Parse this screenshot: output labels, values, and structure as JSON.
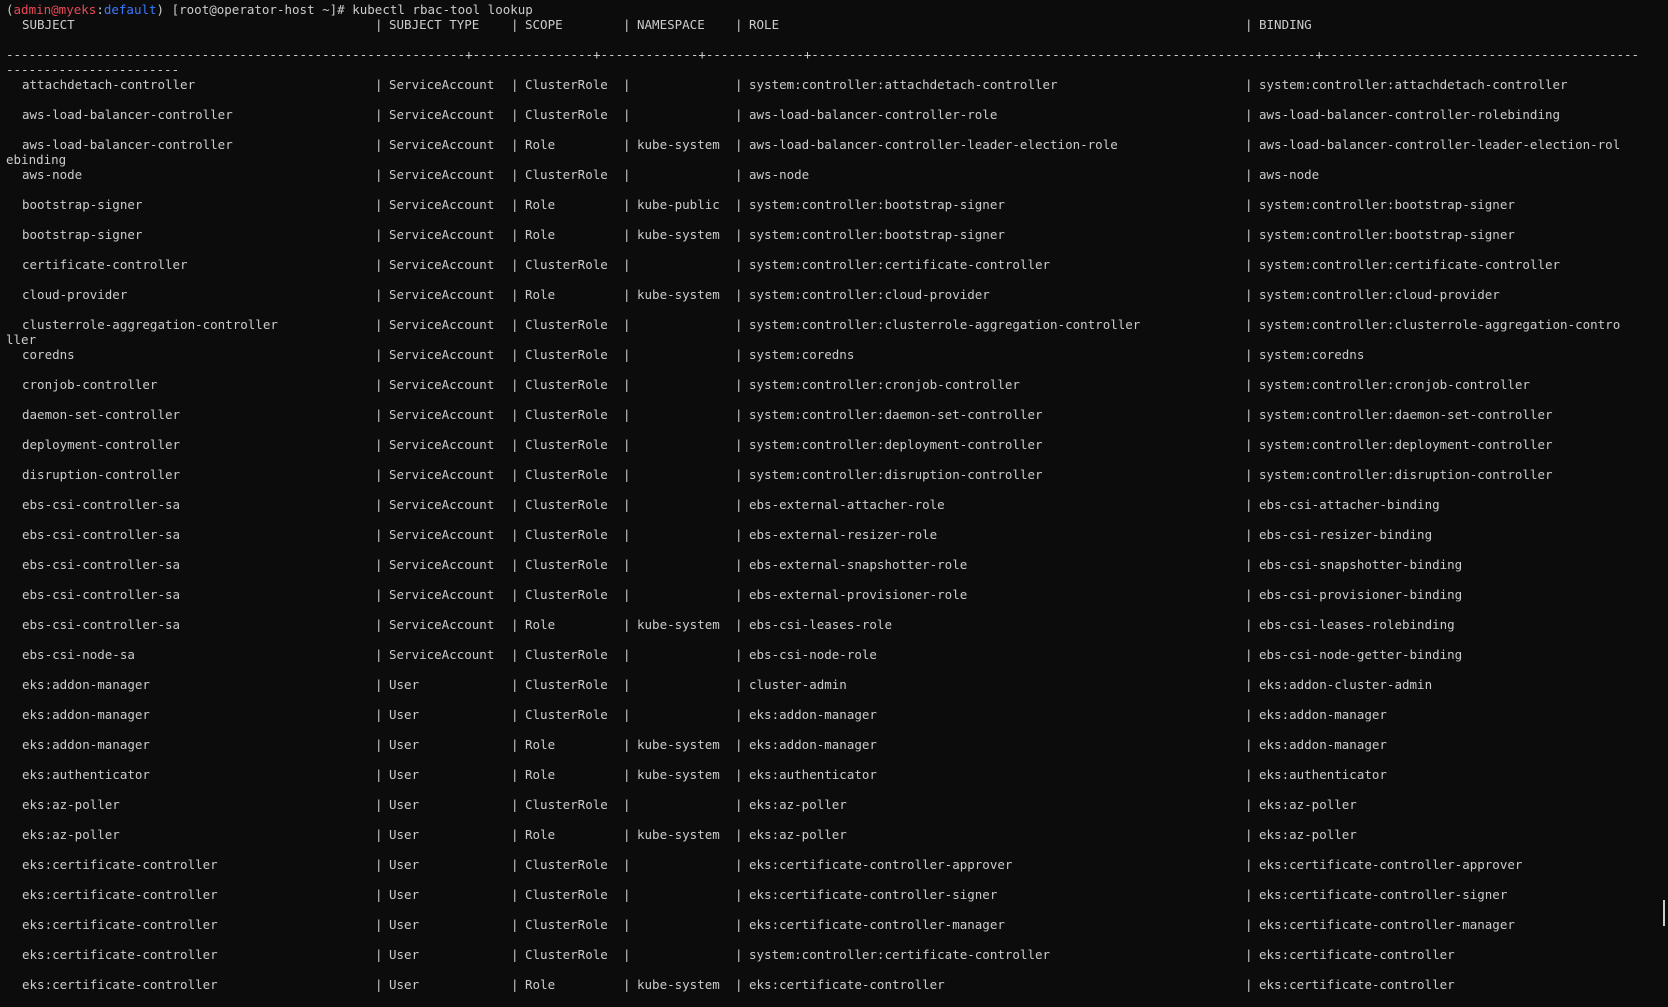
{
  "prompt": {
    "open": "(",
    "user_host": "admin@myeks",
    "sep": ":",
    "context": "default",
    "close": ")",
    "rest": " [root@operator-host ~]# kubectl rbac-tool lookup"
  },
  "header": {
    "subject": "SUBJECT",
    "subject_type": "SUBJECT TYPE",
    "scope": "SCOPE",
    "namespace": "NAMESPACE",
    "role": "ROLE",
    "binding": "BINDING"
  },
  "separator": "-------------------------------------------------------------+----------------+-------------+-------------+-------------------------------------------------------------------+-----------------------------------------------------------------",
  "rows": [
    {
      "subject": "attachdetach-controller",
      "type": "ServiceAccount",
      "scope": "ClusterRole",
      "ns": "",
      "role": "system:controller:attachdetach-controller",
      "binding": "system:controller:attachdetach-controller",
      "wrap": ""
    },
    {
      "subject": "aws-load-balancer-controller",
      "type": "ServiceAccount",
      "scope": "ClusterRole",
      "ns": "",
      "role": "aws-load-balancer-controller-role",
      "binding": "aws-load-balancer-controller-rolebinding",
      "wrap": ""
    },
    {
      "subject": "aws-load-balancer-controller",
      "type": "ServiceAccount",
      "scope": "Role",
      "ns": "kube-system",
      "role": "aws-load-balancer-controller-leader-election-role",
      "binding": "aws-load-balancer-controller-leader-election-rol",
      "wrap": "ebinding"
    },
    {
      "subject": "aws-node",
      "type": "ServiceAccount",
      "scope": "ClusterRole",
      "ns": "",
      "role": "aws-node",
      "binding": "aws-node",
      "wrap": ""
    },
    {
      "subject": "bootstrap-signer",
      "type": "ServiceAccount",
      "scope": "Role",
      "ns": "kube-public",
      "role": "system:controller:bootstrap-signer",
      "binding": "system:controller:bootstrap-signer",
      "wrap": ""
    },
    {
      "subject": "bootstrap-signer",
      "type": "ServiceAccount",
      "scope": "Role",
      "ns": "kube-system",
      "role": "system:controller:bootstrap-signer",
      "binding": "system:controller:bootstrap-signer",
      "wrap": ""
    },
    {
      "subject": "certificate-controller",
      "type": "ServiceAccount",
      "scope": "ClusterRole",
      "ns": "",
      "role": "system:controller:certificate-controller",
      "binding": "system:controller:certificate-controller",
      "wrap": ""
    },
    {
      "subject": "cloud-provider",
      "type": "ServiceAccount",
      "scope": "Role",
      "ns": "kube-system",
      "role": "system:controller:cloud-provider",
      "binding": "system:controller:cloud-provider",
      "wrap": ""
    },
    {
      "subject": "clusterrole-aggregation-controller",
      "type": "ServiceAccount",
      "scope": "ClusterRole",
      "ns": "",
      "role": "system:controller:clusterrole-aggregation-controller",
      "binding": "system:controller:clusterrole-aggregation-contro",
      "wrap": "ller"
    },
    {
      "subject": "coredns",
      "type": "ServiceAccount",
      "scope": "ClusterRole",
      "ns": "",
      "role": "system:coredns",
      "binding": "system:coredns",
      "wrap": ""
    },
    {
      "subject": "cronjob-controller",
      "type": "ServiceAccount",
      "scope": "ClusterRole",
      "ns": "",
      "role": "system:controller:cronjob-controller",
      "binding": "system:controller:cronjob-controller",
      "wrap": ""
    },
    {
      "subject": "daemon-set-controller",
      "type": "ServiceAccount",
      "scope": "ClusterRole",
      "ns": "",
      "role": "system:controller:daemon-set-controller",
      "binding": "system:controller:daemon-set-controller",
      "wrap": ""
    },
    {
      "subject": "deployment-controller",
      "type": "ServiceAccount",
      "scope": "ClusterRole",
      "ns": "",
      "role": "system:controller:deployment-controller",
      "binding": "system:controller:deployment-controller",
      "wrap": ""
    },
    {
      "subject": "disruption-controller",
      "type": "ServiceAccount",
      "scope": "ClusterRole",
      "ns": "",
      "role": "system:controller:disruption-controller",
      "binding": "system:controller:disruption-controller",
      "wrap": ""
    },
    {
      "subject": "ebs-csi-controller-sa",
      "type": "ServiceAccount",
      "scope": "ClusterRole",
      "ns": "",
      "role": "ebs-external-attacher-role",
      "binding": "ebs-csi-attacher-binding",
      "wrap": ""
    },
    {
      "subject": "ebs-csi-controller-sa",
      "type": "ServiceAccount",
      "scope": "ClusterRole",
      "ns": "",
      "role": "ebs-external-resizer-role",
      "binding": "ebs-csi-resizer-binding",
      "wrap": ""
    },
    {
      "subject": "ebs-csi-controller-sa",
      "type": "ServiceAccount",
      "scope": "ClusterRole",
      "ns": "",
      "role": "ebs-external-snapshotter-role",
      "binding": "ebs-csi-snapshotter-binding",
      "wrap": ""
    },
    {
      "subject": "ebs-csi-controller-sa",
      "type": "ServiceAccount",
      "scope": "ClusterRole",
      "ns": "",
      "role": "ebs-external-provisioner-role",
      "binding": "ebs-csi-provisioner-binding",
      "wrap": ""
    },
    {
      "subject": "ebs-csi-controller-sa",
      "type": "ServiceAccount",
      "scope": "Role",
      "ns": "kube-system",
      "role": "ebs-csi-leases-role",
      "binding": "ebs-csi-leases-rolebinding",
      "wrap": ""
    },
    {
      "subject": "ebs-csi-node-sa",
      "type": "ServiceAccount",
      "scope": "ClusterRole",
      "ns": "",
      "role": "ebs-csi-node-role",
      "binding": "ebs-csi-node-getter-binding",
      "wrap": ""
    },
    {
      "subject": "eks:addon-manager",
      "type": "User",
      "scope": "ClusterRole",
      "ns": "",
      "role": "cluster-admin",
      "binding": "eks:addon-cluster-admin",
      "wrap": ""
    },
    {
      "subject": "eks:addon-manager",
      "type": "User",
      "scope": "ClusterRole",
      "ns": "",
      "role": "eks:addon-manager",
      "binding": "eks:addon-manager",
      "wrap": ""
    },
    {
      "subject": "eks:addon-manager",
      "type": "User",
      "scope": "Role",
      "ns": "kube-system",
      "role": "eks:addon-manager",
      "binding": "eks:addon-manager",
      "wrap": ""
    },
    {
      "subject": "eks:authenticator",
      "type": "User",
      "scope": "Role",
      "ns": "kube-system",
      "role": "eks:authenticator",
      "binding": "eks:authenticator",
      "wrap": ""
    },
    {
      "subject": "eks:az-poller",
      "type": "User",
      "scope": "ClusterRole",
      "ns": "",
      "role": "eks:az-poller",
      "binding": "eks:az-poller",
      "wrap": ""
    },
    {
      "subject": "eks:az-poller",
      "type": "User",
      "scope": "Role",
      "ns": "kube-system",
      "role": "eks:az-poller",
      "binding": "eks:az-poller",
      "wrap": ""
    },
    {
      "subject": "eks:certificate-controller",
      "type": "User",
      "scope": "ClusterRole",
      "ns": "",
      "role": "eks:certificate-controller-approver",
      "binding": "eks:certificate-controller-approver",
      "wrap": ""
    },
    {
      "subject": "eks:certificate-controller",
      "type": "User",
      "scope": "ClusterRole",
      "ns": "",
      "role": "eks:certificate-controller-signer",
      "binding": "eks:certificate-controller-signer",
      "wrap": ""
    },
    {
      "subject": "eks:certificate-controller",
      "type": "User",
      "scope": "ClusterRole",
      "ns": "",
      "role": "eks:certificate-controller-manager",
      "binding": "eks:certificate-controller-manager",
      "wrap": ""
    },
    {
      "subject": "eks:certificate-controller",
      "type": "User",
      "scope": "ClusterRole",
      "ns": "",
      "role": "system:controller:certificate-controller",
      "binding": "eks:certificate-controller",
      "wrap": ""
    },
    {
      "subject": "eks:certificate-controller",
      "type": "User",
      "scope": "Role",
      "ns": "kube-system",
      "role": "eks:certificate-controller",
      "binding": "eks:certificate-controller",
      "wrap": ""
    }
  ]
}
